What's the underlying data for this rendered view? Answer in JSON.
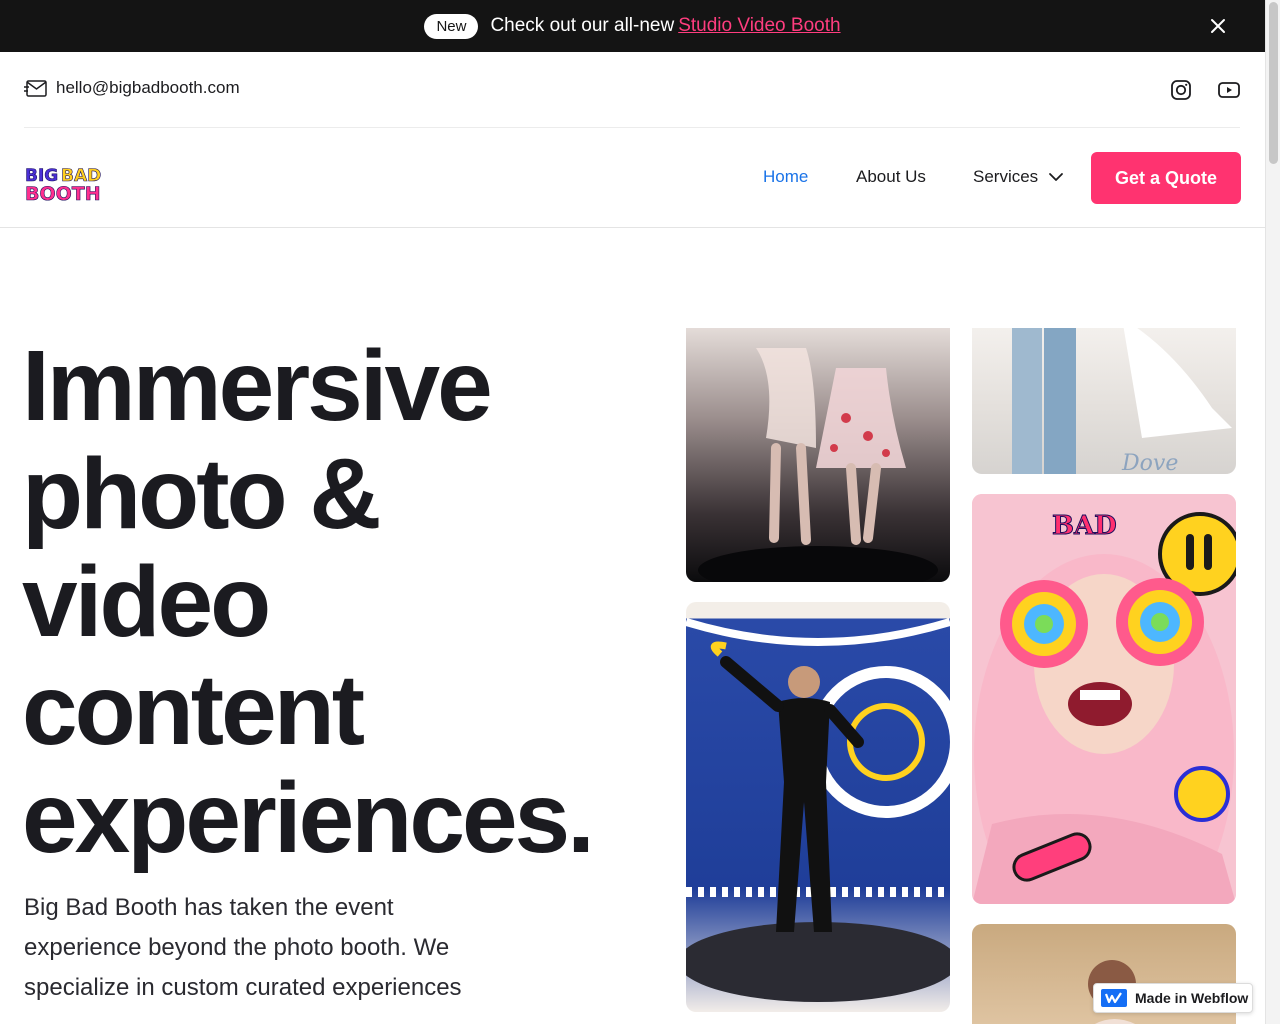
{
  "announcement": {
    "badge": "New",
    "text": "Check out our all-new",
    "link": "Studio Video Booth"
  },
  "contact": {
    "email": "hello@bigbadbooth.com"
  },
  "social": [
    "instagram-icon",
    "youtube-icon"
  ],
  "nav": {
    "logo_text": "BIG BAD BOOTH",
    "items": {
      "home": "Home",
      "about": "About Us",
      "services": "Services"
    },
    "cta": "Get a Quote"
  },
  "hero": {
    "title_lines": [
      "Immersive",
      "photo &",
      "video",
      "content",
      "experiences."
    ],
    "body": "Big Bad Booth has taken the event experience beyond the photo booth. We specialize in custom curated experiences"
  },
  "gallery": {
    "tile_b_caption": "Dove",
    "tile_d_caption": "BAD"
  },
  "webflow_badge": "Made in Webflow",
  "colors": {
    "accent": "#ff3370",
    "link": "#ff3d7f",
    "nav_active": "#1a73e8",
    "announce_bg": "#141414"
  }
}
